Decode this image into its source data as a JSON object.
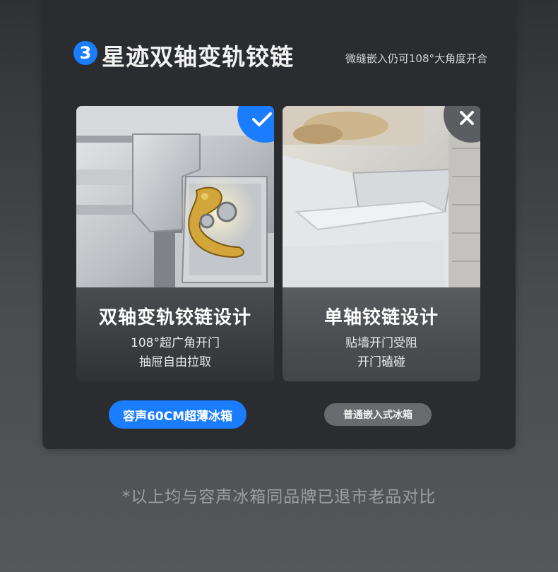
{
  "header": {
    "step_number": "3",
    "title": "星迹双轴变轨铰链",
    "subtitle": "微缝嵌入仍可108°大角度开合"
  },
  "left_panel": {
    "title": "双轴变轨铰链设计",
    "line1": "108°超广角开门",
    "line2": "抽屉自由拉取",
    "badge_icon": "checkmark-icon",
    "tag": "容声60CM超薄冰箱"
  },
  "right_panel": {
    "title": "单轴铰链设计",
    "line1": "贴墙开门受阻",
    "line2": "开门磕碰",
    "badge_icon": "cross-icon",
    "tag": "普通嵌入式冰箱"
  },
  "footnote": "*以上均与容声冰箱同品牌已退市老品对比",
  "colors": {
    "accent": "#1a7dff",
    "card": "#2a2c2f",
    "muted_tag": "#6a6b6e"
  }
}
